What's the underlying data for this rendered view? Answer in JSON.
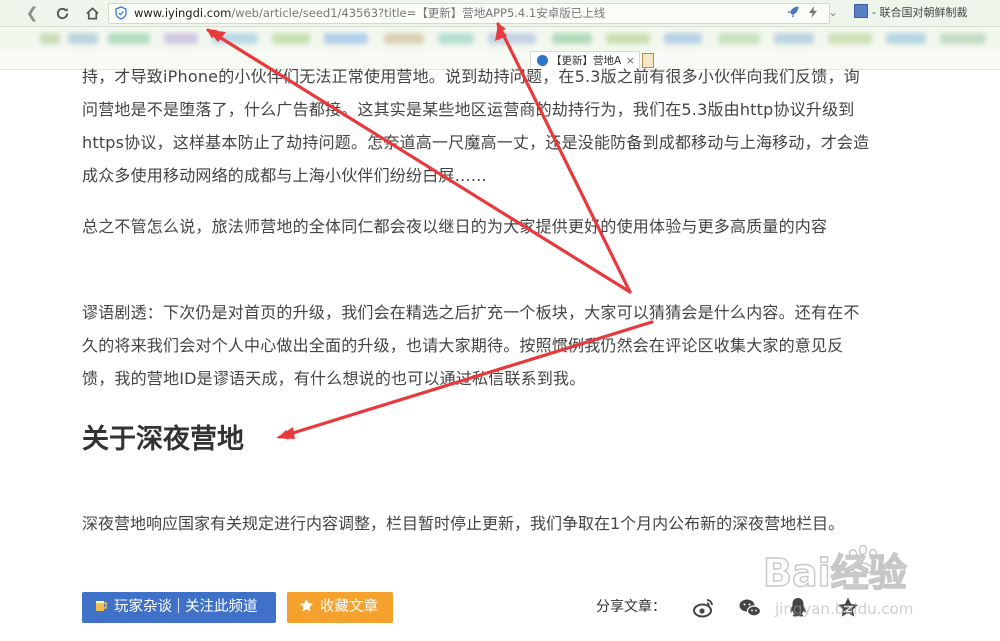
{
  "browser": {
    "url_host": "www.iyingdi.com",
    "url_path": "/web/article/seed1/43563?title=【更新】营地APP5.4.1安卓版已上线",
    "right_tab_label": "联合国对朝鲜制裁",
    "active_tab_label": "【更新】营地A",
    "tab_close": "×"
  },
  "article": {
    "paragraphs": [
      "持，才导致iPhone的小伙伴们无法正常使用营地。说到劫持问题，在5.3版之前有很多小伙伴向我们反馈，询问营地是不是堕落了，什么广告都接。这其实是某些地区运营商的劫持行为，我们在5.3版由http协议升级到https协议，这样基本防止了劫持问题。怎奈道高一尺魔高一丈，还是没能防备到成都移动与上海移动，才会造成众多使用移动网络的成都与上海小伙伴们纷纷白屏……",
      "总之不管怎么说，旅法师营地的全体同仁都会夜以继日的为大家提供更好的使用体验与更多高质量的内容",
      "谬语剧透：下次仍是对首页的升级，我们会在精选之后扩充一个板块，大家可以猜猜会是什么内容。还有在不久的将来我们会对个人中心做出全面的升级，也请大家期待。按照惯例我仍然会在评论区收集大家的意见反馈，我的营地ID是谬语天成，有什么想说的也可以通过私信联系到我。"
    ],
    "section_heading": "关于深夜营地",
    "section_paragraph": "深夜营地响应国家有关规定进行内容调整，栏目暂时停止更新，我们争取在1个月内公布新的深夜营地栏目。"
  },
  "actions": {
    "channel_name": "玩家杂谈",
    "follow_label": "关注此频道",
    "favorite_label": "收藏文章",
    "share_label": "分享文章：",
    "share_icons": [
      "weibo-icon",
      "wechat-icon",
      "qq-icon",
      "qzone-icon"
    ]
  },
  "watermark": {
    "text": "Bai经验",
    "subtext": "jingyan.baidu.com"
  },
  "colors": {
    "annotation_arrow": "#e8393d",
    "button_blue": "#3f71c8",
    "button_orange": "#f4a12e",
    "toolbar_bg": "#eef5ea"
  }
}
